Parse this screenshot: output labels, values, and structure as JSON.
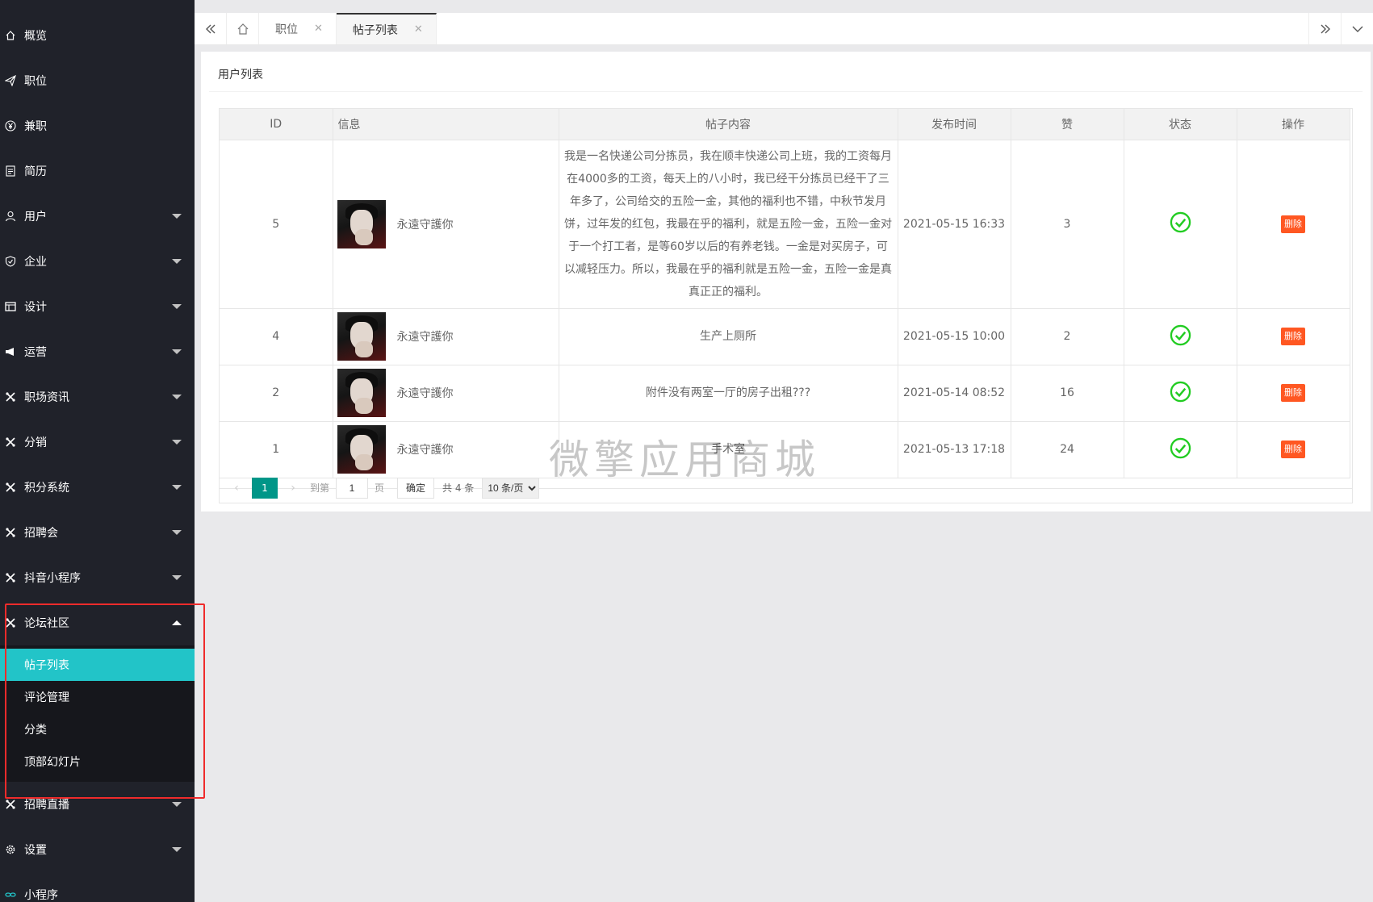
{
  "sidebar": {
    "items": [
      {
        "label": "概览",
        "icon": "home-icon",
        "expandable": false
      },
      {
        "label": "职位",
        "icon": "send-icon",
        "expandable": false
      },
      {
        "label": "兼职",
        "icon": "yen-icon",
        "expandable": false
      },
      {
        "label": "简历",
        "icon": "document-icon",
        "expandable": false
      },
      {
        "label": "用户",
        "icon": "user-icon",
        "expandable": true
      },
      {
        "label": "企业",
        "icon": "shield-icon",
        "expandable": true
      },
      {
        "label": "设计",
        "icon": "layout-icon",
        "expandable": true
      },
      {
        "label": "运营",
        "icon": "bullhorn-icon",
        "expandable": true
      },
      {
        "label": "职场资讯",
        "icon": "tools-icon",
        "expandable": true
      },
      {
        "label": "分销",
        "icon": "tools-icon",
        "expandable": true
      },
      {
        "label": "积分系统",
        "icon": "tools-icon",
        "expandable": true
      },
      {
        "label": "招聘会",
        "icon": "tools-icon",
        "expandable": true
      },
      {
        "label": "抖音小程序",
        "icon": "tools-icon",
        "expandable": true
      },
      {
        "label": "论坛社区",
        "icon": "tools-icon",
        "expandable": true,
        "expanded": true
      }
    ],
    "forum_submenu": [
      {
        "label": "帖子列表",
        "active": true
      },
      {
        "label": "评论管理",
        "active": false
      },
      {
        "label": "分类",
        "active": false
      },
      {
        "label": "顶部幻灯片",
        "active": false
      }
    ],
    "items_after": [
      {
        "label": "招聘直播",
        "icon": "tools-icon",
        "expandable": true
      },
      {
        "label": "设置",
        "icon": "gear-icon",
        "expandable": true
      },
      {
        "label": "小程序",
        "icon": "link-icon",
        "expandable": false
      }
    ],
    "active_color": "#22c4c8",
    "highlight_color": "#f02b2b"
  },
  "tabs": [
    {
      "label": "职位",
      "active": false
    },
    {
      "label": "帖子列表",
      "active": true
    }
  ],
  "card": {
    "title": "用户列表"
  },
  "table": {
    "headers": {
      "id": "ID",
      "info": "信息",
      "content": "帖子内容",
      "time": "发布时间",
      "likes": "赞",
      "status": "状态",
      "action": "操作"
    },
    "rows": [
      {
        "id": "5",
        "name": "永遠守護你",
        "content": "我是一名快递公司分拣员，我在顺丰快递公司上班，我的工资每月在4000多的工资，每天上的八小时，我已经干分拣员已经干了三年多了，公司给交的五险一金，其他的福利也不错，中秋节发月饼，过年发的红包，我最在乎的福利，就是五险一金，五险一金对于一个打工者，是等60岁以后的有养老钱。一金是对买房子，可以减轻压力。所以，我最在乎的福利就是五险一金，五险一金是真真正正的福利。",
        "time": "2021-05-15 16:33",
        "likes": "3",
        "delete_label": "删除"
      },
      {
        "id": "4",
        "name": "永遠守護你",
        "content": "生产上厕所",
        "time": "2021-05-15 10:00",
        "likes": "2",
        "delete_label": "删除"
      },
      {
        "id": "2",
        "name": "永遠守護你",
        "content": "附件没有两室一厅的房子出租???",
        "time": "2021-05-14 08:52",
        "likes": "16",
        "delete_label": "删除"
      },
      {
        "id": "1",
        "name": "永遠守護你",
        "content": "手术室",
        "time": "2021-05-13 17:18",
        "likes": "24",
        "delete_label": "删除"
      }
    ],
    "status_color": "#22cc22",
    "delete_color": "#ff5722"
  },
  "pager": {
    "current_page": "1",
    "goto_label": "到第",
    "page_unit": "页",
    "jump_value": "1",
    "confirm_label": "确定",
    "total_label": "共 4 条",
    "page_size_label": "10 条/页"
  },
  "watermark": "微擎应用商城"
}
